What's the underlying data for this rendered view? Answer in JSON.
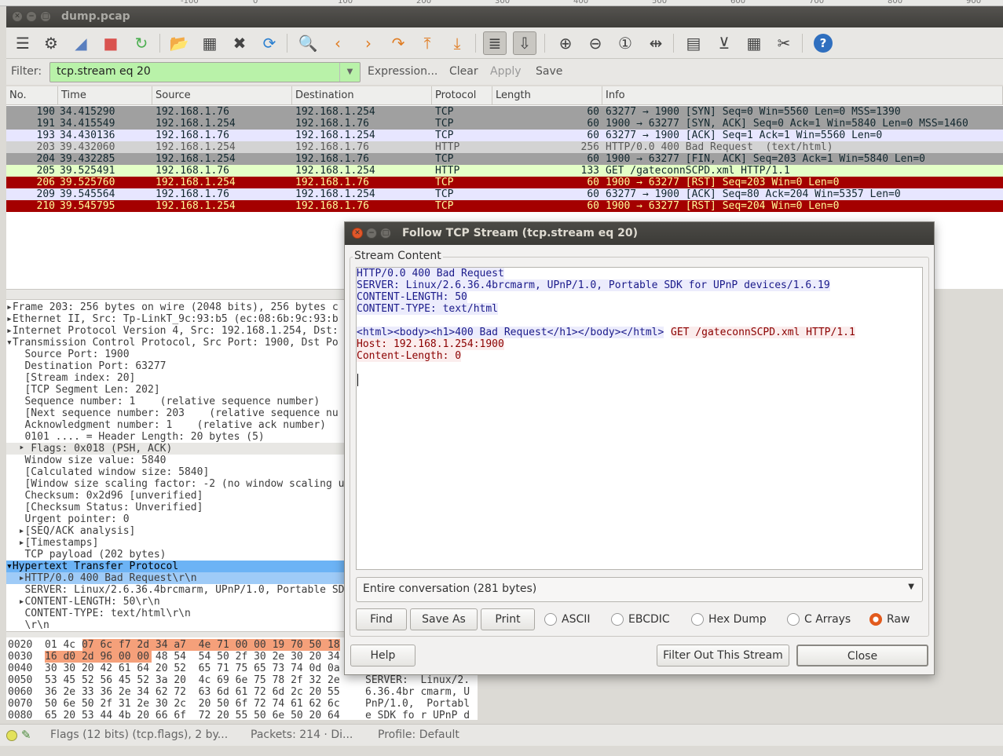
{
  "window": {
    "title": "dump.pcap"
  },
  "ruler_ticks": [
    "-100",
    "0",
    "100",
    "200",
    "300",
    "400",
    "500",
    "600",
    "700",
    "800",
    "900"
  ],
  "toolbar_icons": [
    "interfaces-icon",
    "options-icon",
    "start-capture-icon",
    "stop-capture-icon",
    "restart-capture-icon",
    "open-file-icon",
    "save-file-icon",
    "close-file-icon",
    "reload-icon",
    "find-packet-icon",
    "go-back-icon",
    "go-forward-icon",
    "go-to-packet-icon",
    "first-packet-icon",
    "last-packet-icon",
    "colorize-icon",
    "auto-scroll-icon",
    "zoom-in-icon",
    "zoom-out-icon",
    "normal-size-icon",
    "resize-columns-icon",
    "capture-filters-icon",
    "display-filters-icon",
    "coloring-rules-icon",
    "preferences-icon",
    "help-icon"
  ],
  "filter": {
    "label": "Filter:",
    "value": "tcp.stream eq 20",
    "expression": "Expression...",
    "clear": "Clear",
    "apply": "Apply",
    "save": "Save"
  },
  "columns": [
    "No.",
    "Time",
    "Source",
    "Destination",
    "Protocol",
    "Length",
    "Info"
  ],
  "packets": [
    {
      "no": "190",
      "time": "34.415290",
      "src": "192.168.1.76",
      "dst": "192.168.1.254",
      "proto": "TCP",
      "len": "60",
      "info": "63277 → 1900 [SYN] Seq=0 Win=5560 Len=0 MSS=1390",
      "bg": "#a0a0a0",
      "fg": "#12272e"
    },
    {
      "no": "191",
      "time": "34.415549",
      "src": "192.168.1.254",
      "dst": "192.168.1.76",
      "proto": "TCP",
      "len": "60",
      "info": "1900 → 63277 [SYN, ACK] Seq=0 Ack=1 Win=5840 Len=0 MSS=1460",
      "bg": "#a0a0a0",
      "fg": "#12272e"
    },
    {
      "no": "193",
      "time": "34.430136",
      "src": "192.168.1.76",
      "dst": "192.168.1.254",
      "proto": "TCP",
      "len": "60",
      "info": "63277 → 1900 [ACK] Seq=1 Ack=1 Win=5560 Len=0",
      "bg": "#e7e6ff",
      "fg": "#12272e"
    },
    {
      "no": "203",
      "time": "39.432060",
      "src": "192.168.1.254",
      "dst": "192.168.1.76",
      "proto": "HTTP",
      "len": "256",
      "info": "HTTP/0.0 400 Bad Request  (text/html)",
      "bg": "#d3d3d3",
      "fg": "#5a5a5a"
    },
    {
      "no": "204",
      "time": "39.432285",
      "src": "192.168.1.254",
      "dst": "192.168.1.76",
      "proto": "TCP",
      "len": "60",
      "info": "1900 → 63277 [FIN, ACK] Seq=203 Ack=1 Win=5840 Len=0",
      "bg": "#a0a0a0",
      "fg": "#12272e"
    },
    {
      "no": "205",
      "time": "39.525491",
      "src": "192.168.1.76",
      "dst": "192.168.1.254",
      "proto": "HTTP",
      "len": "133",
      "info": "GET /gateconnSCPD.xml HTTP/1.1",
      "bg": "#e4ffc7",
      "fg": "#12272e"
    },
    {
      "no": "206",
      "time": "39.525760",
      "src": "192.168.1.254",
      "dst": "192.168.1.76",
      "proto": "TCP",
      "len": "60",
      "info": "1900 → 63277 [RST] Seq=203 Win=0 Len=0",
      "bg": "#a40000",
      "fg": "#fffc9c"
    },
    {
      "no": "209",
      "time": "39.545564",
      "src": "192.168.1.76",
      "dst": "192.168.1.254",
      "proto": "TCP",
      "len": "60",
      "info": "63277 → 1900 [ACK] Seq=80 Ack=204 Win=5357 Len=0",
      "bg": "#e7e6ff",
      "fg": "#12272e"
    },
    {
      "no": "210",
      "time": "39.545795",
      "src": "192.168.1.254",
      "dst": "192.168.1.76",
      "proto": "TCP",
      "len": "60",
      "info": "1900 → 63277 [RST] Seq=204 Win=0 Len=0",
      "bg": "#a40000",
      "fg": "#fffc9c"
    }
  ],
  "details": [
    {
      "text": "▸Frame 203: 256 bytes on wire (2048 bits), 256 bytes c"
    },
    {
      "text": "▸Ethernet II, Src: Tp-LinkT_9c:93:b5 (ec:08:6b:9c:93:b"
    },
    {
      "text": "▸Internet Protocol Version 4, Src: 192.168.1.254, Dst:"
    },
    {
      "text": "▾Transmission Control Protocol, Src Port: 1900, Dst Po"
    },
    {
      "text": "   Source Port: 1900"
    },
    {
      "text": "   Destination Port: 63277"
    },
    {
      "text": "   [Stream index: 20]"
    },
    {
      "text": "   [TCP Segment Len: 202]"
    },
    {
      "text": "   Sequence number: 1    (relative sequence number)"
    },
    {
      "text": "   [Next sequence number: 203    (relative sequence nu"
    },
    {
      "text": "   Acknowledgment number: 1    (relative ack number)"
    },
    {
      "text": "   0101 .... = Header Length: 20 bytes (5)"
    },
    {
      "text": "  ‣ Flags: 0x018 (PSH, ACK)"
    },
    {
      "text": "   Window size value: 5840"
    },
    {
      "text": "   [Calculated window size: 5840]"
    },
    {
      "text": "   [Window size scaling factor: -2 (no window scaling u"
    },
    {
      "text": "   Checksum: 0x2d96 [unverified]"
    },
    {
      "text": "   [Checksum Status: Unverified]"
    },
    {
      "text": "   Urgent pointer: 0"
    },
    {
      "text": "  ▸[SEQ/ACK analysis]"
    },
    {
      "text": "  ▸[Timestamps]"
    },
    {
      "text": "   TCP payload (202 bytes)"
    },
    {
      "text": "▾Hypertext Transfer Protocol"
    },
    {
      "text": "  ▸HTTP/0.0 400 Bad Request\\r\\n"
    },
    {
      "text": "   SERVER: Linux/2.6.36.4brcmarm, UPnP/1.0, Portable SD"
    },
    {
      "text": "  ▸CONTENT-LENGTH: 50\\r\\n"
    },
    {
      "text": "   CONTENT-TYPE: text/html\\r\\n"
    },
    {
      "text": "   \\r\\n"
    }
  ],
  "hex": [
    {
      "offset": "0020",
      "bytes": "01 4c 07 6c f7 2d 34 a7  4e 71 00 00 19 70 50 18",
      "ascii": ""
    },
    {
      "offset": "0030",
      "bytes": "16 d0 2d 96 00 00 48 54  54 50 2f 30 2e 30 20 34",
      "ascii": ""
    },
    {
      "offset": "0040",
      "bytes": "30 30 20 42 61 64 20 52  65 71 75 65 73 74 0d 0a",
      "ascii": ""
    },
    {
      "offset": "0050",
      "bytes": "53 45 52 56 45 52 3a 20  4c 69 6e 75 78 2f 32 2e",
      "ascii": "SERVER:  Linux/2."
    },
    {
      "offset": "0060",
      "bytes": "36 2e 33 36 2e 34 62 72  63 6d 61 72 6d 2c 20 55",
      "ascii": "6.36.4br cmarm, U"
    },
    {
      "offset": "0070",
      "bytes": "50 6e 50 2f 31 2e 30 2c  20 50 6f 72 74 61 62 6c",
      "ascii": "PnP/1.0,  Portabl"
    },
    {
      "offset": "0080",
      "bytes": "65 20 53 44 4b 20 66 6f  72 20 55 50 6e 50 20 64",
      "ascii": "e SDK fo r UPnP d"
    }
  ],
  "status": {
    "field": "Flags (12 bits) (tcp.flags), 2 by...",
    "packets": "Packets: 214 · Di...",
    "profile": "Profile: Default"
  },
  "dialog": {
    "title": "Follow TCP Stream (tcp.stream eq 20)",
    "stream_label": "Stream Content",
    "lines": [
      {
        "text": "HTTP/0.0 400 Bad Request",
        "dir": "cli"
      },
      {
        "text": "SERVER: Linux/2.6.36.4brcmarm, UPnP/1.0, Portable SDK for UPnP devices/1.6.19",
        "dir": "cli"
      },
      {
        "text": "CONTENT-LENGTH: 50",
        "dir": "cli"
      },
      {
        "text": "CONTENT-TYPE: text/html",
        "dir": "cli"
      },
      {
        "text": "",
        "dir": "none"
      },
      {
        "text": "<html><body><h1>400 Bad Request</h1></body></html>",
        "dir": "cli"
      },
      {
        "text": "Host: 192.168.1.254:1900",
        "dir": "srv"
      },
      {
        "text": "Content-Length: 0",
        "dir": "srv"
      }
    ],
    "get_line": "GET /gateconnSCPD.xml HTTP/1.1",
    "conversation": "Entire conversation (281 bytes)",
    "find": "Find",
    "save_as": "Save As",
    "print": "Print",
    "formats": [
      "ASCII",
      "EBCDIC",
      "Hex Dump",
      "C Arrays",
      "Raw"
    ],
    "selected_format": "Raw",
    "help": "Help",
    "filter_out": "Filter Out This Stream",
    "close": "Close"
  }
}
